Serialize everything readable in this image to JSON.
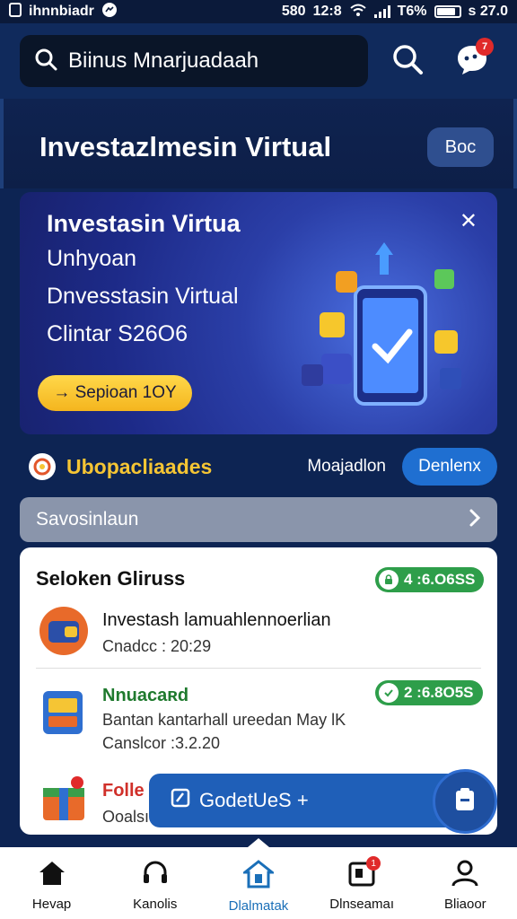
{
  "status_bar": {
    "app_name": "ihnnbiadr",
    "left_time": "580",
    "clock": "12:8",
    "battery_pct": "T6%",
    "extra": "s 27.0"
  },
  "search": {
    "placeholder": "Biinus Mnarjuadaah"
  },
  "notifications": {
    "count": "7"
  },
  "header": {
    "title": "Investazlmesin Virtual",
    "button_label": "Boc"
  },
  "banner": {
    "title": "Investasin Virtua",
    "line1": "Unhyoan",
    "line2": "Dnvesstasin Virtual",
    "line3": "Clintar S26O6",
    "cta_label": "→ Sepioan 1OY",
    "close_label": "✕"
  },
  "section": {
    "title": "Ubopacliaades",
    "link_label": "Moajadlon",
    "button_label": "Denlenx"
  },
  "filter": {
    "label": "Savosinlaun",
    "chevron": "›"
  },
  "card": {
    "title": "Seloken Gliruss",
    "pill_value": "4 :6.O6SS",
    "items": [
      {
        "title": "Investash lamuahlennoerlian",
        "sub": "Cnadcc : 20:29"
      },
      {
        "title": "Nnuacaʀd",
        "pill_value": "2 :6.8O5S",
        "sub": "Bantan kantarhall ureedan May lK",
        "sub2": "Canslcor :3.2.20"
      },
      {
        "title": "Folle",
        "sub": "Ooalsı"
      }
    ]
  },
  "fab": {
    "label": "GodetUeS +"
  },
  "bottom_nav": {
    "items": [
      {
        "label": "Hevap"
      },
      {
        "label": "Kanolis"
      },
      {
        "label": "Dlalmatak"
      },
      {
        "label": "Dlnseamaı",
        "badge": "1"
      },
      {
        "label": "Bliaoor"
      }
    ]
  },
  "colors": {
    "primary_bg": "#0d2453",
    "accent_blue": "#1f6fd1",
    "accent_yellow": "#f5c534",
    "success_green": "#2e9e4a",
    "badge_red": "#e02a2a"
  }
}
